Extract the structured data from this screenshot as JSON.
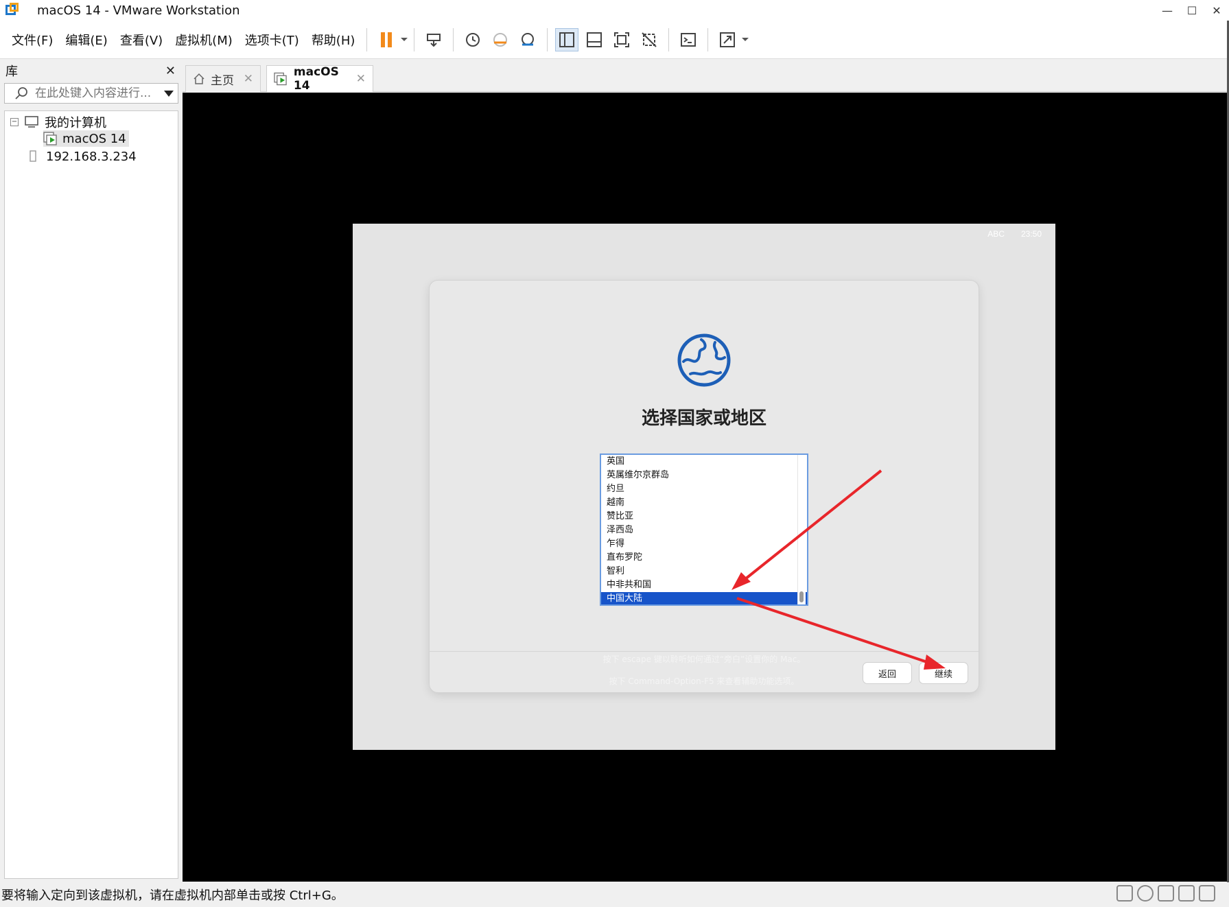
{
  "window": {
    "title": "macOS 14 - VMware Workstation",
    "controls": {
      "minimize": "—",
      "maximize": "☐",
      "close": "✕"
    }
  },
  "menu": {
    "file": "文件(F)",
    "edit": "编辑(E)",
    "view": "查看(V)",
    "vm": "虚拟机(M)",
    "tabs": "选项卡(T)",
    "help": "帮助(H)"
  },
  "library": {
    "title": "库",
    "close": "✕",
    "search_placeholder": "在此处键入内容进行...",
    "tree": {
      "my_computer": "我的计算机",
      "vm_name": "macOS 14",
      "remote_host": "192.168.3.234"
    }
  },
  "tabs": {
    "home": "主页",
    "vm": "macOS 14",
    "close": "✕"
  },
  "mac": {
    "status_input": "ABC",
    "status_time": "23:50",
    "dialog_title": "选择国家或地区",
    "countries": [
      "英国",
      "英属维尔京群岛",
      "约旦",
      "越南",
      "赞比亚",
      "泽西岛",
      "乍得",
      "直布罗陀",
      "智利",
      "中非共和国",
      "中国大陆"
    ],
    "selected_country": "中国大陆",
    "back_button": "返回",
    "continue_button": "继续",
    "hint1": "按下 escape 键以聆听如何通过“旁白”设置你的 Mac。",
    "hint2": "按下 Command-Option-F5 来查看辅助功能选项。"
  },
  "statusbar": {
    "text": "要将输入定向到该虚拟机，请在虚拟机内部单击或按 Ctrl+G。"
  },
  "colors": {
    "selection": "#1754c9",
    "arrow": "#e8262b",
    "pause": "#f28a1b",
    "globe": "#1d5fb7"
  }
}
